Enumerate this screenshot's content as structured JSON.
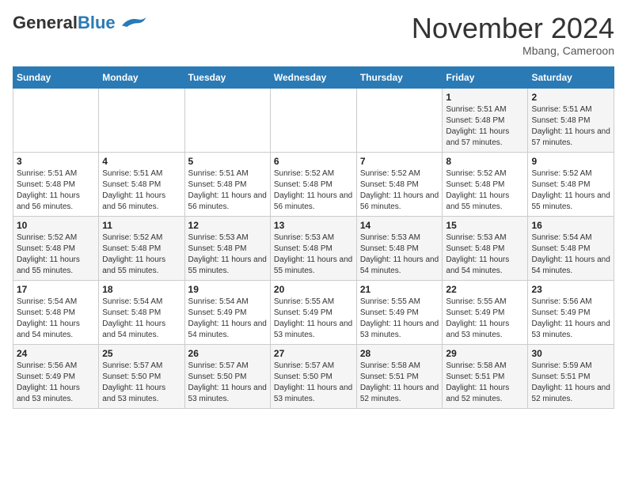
{
  "header": {
    "logo_general": "General",
    "logo_blue": "Blue",
    "month_title": "November 2024",
    "location": "Mbang, Cameroon"
  },
  "days_of_week": [
    "Sunday",
    "Monday",
    "Tuesday",
    "Wednesday",
    "Thursday",
    "Friday",
    "Saturday"
  ],
  "weeks": [
    [
      {
        "day": "",
        "info": ""
      },
      {
        "day": "",
        "info": ""
      },
      {
        "day": "",
        "info": ""
      },
      {
        "day": "",
        "info": ""
      },
      {
        "day": "",
        "info": ""
      },
      {
        "day": "1",
        "info": "Sunrise: 5:51 AM\nSunset: 5:48 PM\nDaylight: 11 hours and 57 minutes."
      },
      {
        "day": "2",
        "info": "Sunrise: 5:51 AM\nSunset: 5:48 PM\nDaylight: 11 hours and 57 minutes."
      }
    ],
    [
      {
        "day": "3",
        "info": "Sunrise: 5:51 AM\nSunset: 5:48 PM\nDaylight: 11 hours and 56 minutes."
      },
      {
        "day": "4",
        "info": "Sunrise: 5:51 AM\nSunset: 5:48 PM\nDaylight: 11 hours and 56 minutes."
      },
      {
        "day": "5",
        "info": "Sunrise: 5:51 AM\nSunset: 5:48 PM\nDaylight: 11 hours and 56 minutes."
      },
      {
        "day": "6",
        "info": "Sunrise: 5:52 AM\nSunset: 5:48 PM\nDaylight: 11 hours and 56 minutes."
      },
      {
        "day": "7",
        "info": "Sunrise: 5:52 AM\nSunset: 5:48 PM\nDaylight: 11 hours and 56 minutes."
      },
      {
        "day": "8",
        "info": "Sunrise: 5:52 AM\nSunset: 5:48 PM\nDaylight: 11 hours and 55 minutes."
      },
      {
        "day": "9",
        "info": "Sunrise: 5:52 AM\nSunset: 5:48 PM\nDaylight: 11 hours and 55 minutes."
      }
    ],
    [
      {
        "day": "10",
        "info": "Sunrise: 5:52 AM\nSunset: 5:48 PM\nDaylight: 11 hours and 55 minutes."
      },
      {
        "day": "11",
        "info": "Sunrise: 5:52 AM\nSunset: 5:48 PM\nDaylight: 11 hours and 55 minutes."
      },
      {
        "day": "12",
        "info": "Sunrise: 5:53 AM\nSunset: 5:48 PM\nDaylight: 11 hours and 55 minutes."
      },
      {
        "day": "13",
        "info": "Sunrise: 5:53 AM\nSunset: 5:48 PM\nDaylight: 11 hours and 55 minutes."
      },
      {
        "day": "14",
        "info": "Sunrise: 5:53 AM\nSunset: 5:48 PM\nDaylight: 11 hours and 54 minutes."
      },
      {
        "day": "15",
        "info": "Sunrise: 5:53 AM\nSunset: 5:48 PM\nDaylight: 11 hours and 54 minutes."
      },
      {
        "day": "16",
        "info": "Sunrise: 5:54 AM\nSunset: 5:48 PM\nDaylight: 11 hours and 54 minutes."
      }
    ],
    [
      {
        "day": "17",
        "info": "Sunrise: 5:54 AM\nSunset: 5:48 PM\nDaylight: 11 hours and 54 minutes."
      },
      {
        "day": "18",
        "info": "Sunrise: 5:54 AM\nSunset: 5:48 PM\nDaylight: 11 hours and 54 minutes."
      },
      {
        "day": "19",
        "info": "Sunrise: 5:54 AM\nSunset: 5:49 PM\nDaylight: 11 hours and 54 minutes."
      },
      {
        "day": "20",
        "info": "Sunrise: 5:55 AM\nSunset: 5:49 PM\nDaylight: 11 hours and 53 minutes."
      },
      {
        "day": "21",
        "info": "Sunrise: 5:55 AM\nSunset: 5:49 PM\nDaylight: 11 hours and 53 minutes."
      },
      {
        "day": "22",
        "info": "Sunrise: 5:55 AM\nSunset: 5:49 PM\nDaylight: 11 hours and 53 minutes."
      },
      {
        "day": "23",
        "info": "Sunrise: 5:56 AM\nSunset: 5:49 PM\nDaylight: 11 hours and 53 minutes."
      }
    ],
    [
      {
        "day": "24",
        "info": "Sunrise: 5:56 AM\nSunset: 5:49 PM\nDaylight: 11 hours and 53 minutes."
      },
      {
        "day": "25",
        "info": "Sunrise: 5:57 AM\nSunset: 5:50 PM\nDaylight: 11 hours and 53 minutes."
      },
      {
        "day": "26",
        "info": "Sunrise: 5:57 AM\nSunset: 5:50 PM\nDaylight: 11 hours and 53 minutes."
      },
      {
        "day": "27",
        "info": "Sunrise: 5:57 AM\nSunset: 5:50 PM\nDaylight: 11 hours and 53 minutes."
      },
      {
        "day": "28",
        "info": "Sunrise: 5:58 AM\nSunset: 5:51 PM\nDaylight: 11 hours and 52 minutes."
      },
      {
        "day": "29",
        "info": "Sunrise: 5:58 AM\nSunset: 5:51 PM\nDaylight: 11 hours and 52 minutes."
      },
      {
        "day": "30",
        "info": "Sunrise: 5:59 AM\nSunset: 5:51 PM\nDaylight: 11 hours and 52 minutes."
      }
    ]
  ]
}
